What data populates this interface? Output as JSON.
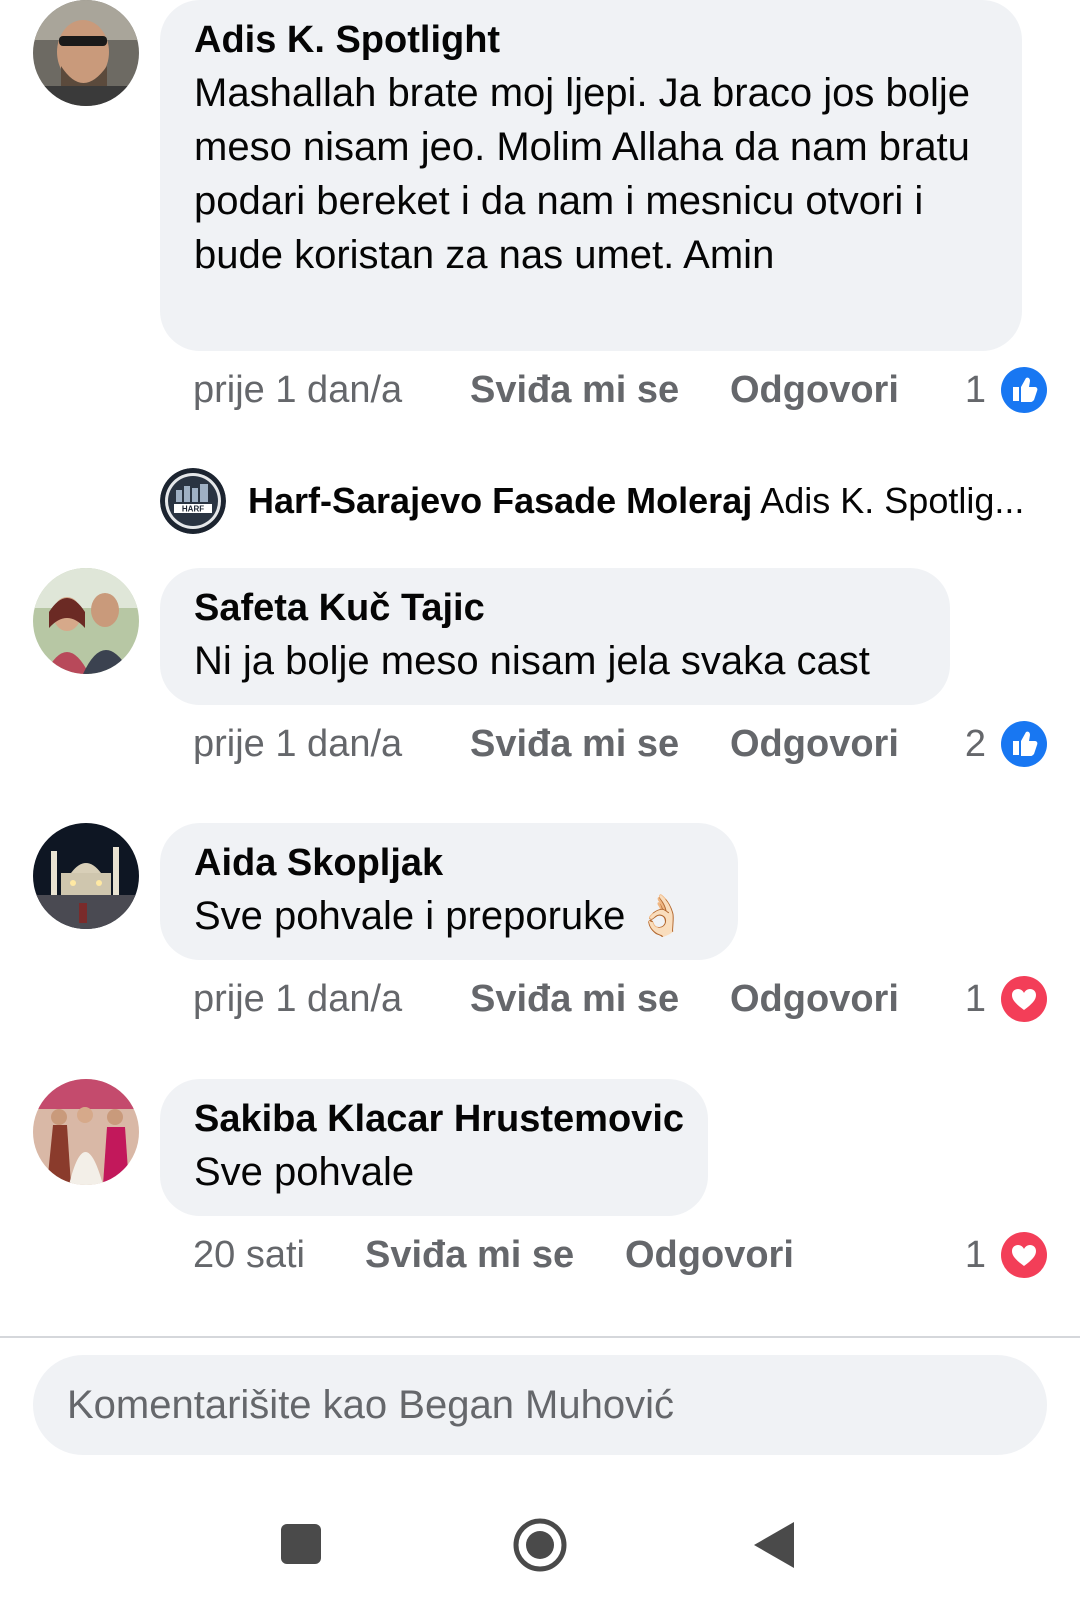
{
  "comments": [
    {
      "author": "Adis K. Spotlight",
      "text": "Mashallah brate moj ljepi. Ja braco jos bolje meso nisam jeo. Molim Allaha da nam bratu podari bereket i da nam i mesnicu otvori i bude koristan za nas umet. Amin",
      "time": "prije 1 dan/a",
      "like_label": "Sviđa mi se",
      "reply_label": "Odgovori",
      "reaction_count": "1",
      "reaction_icon": "like-icon"
    },
    {
      "author": "Safeta Kuč Tajic",
      "text": "Ni ja bolje meso nisam jela svaka cast",
      "time": "prije 1 dan/a",
      "like_label": "Sviđa mi se",
      "reply_label": "Odgovori",
      "reaction_count": "2",
      "reaction_icon": "like-icon"
    },
    {
      "author": "Aida Skopljak",
      "text": "Sve pohvale i preporuke 👌🏻",
      "time": "prije 1 dan/a",
      "like_label": "Sviđa mi se",
      "reply_label": "Odgovori",
      "reaction_count": "1",
      "reaction_icon": "heart-icon"
    },
    {
      "author": "Sakiba Klacar Hrustemovic",
      "text": "Sve pohvale",
      "time": "20 sati",
      "like_label": "Sviđa mi se",
      "reply_label": "Odgovori",
      "reaction_count": "1",
      "reaction_icon": "heart-icon"
    }
  ],
  "reply": {
    "author": "Harf-Sarajevo Fasade Moleraj",
    "snippet": "Adis K. Spotlig...",
    "logo_text": "HARF"
  },
  "composer": {
    "placeholder": "Komentarišite kao Began Muhović"
  },
  "colors": {
    "bubble_bg": "#f0f2f5",
    "meta_text": "#65676b",
    "like_blue": "#1877f2",
    "heart_red": "#f33e58"
  },
  "navbar": {
    "buttons": [
      "recent-apps-icon",
      "home-icon",
      "back-icon"
    ]
  }
}
